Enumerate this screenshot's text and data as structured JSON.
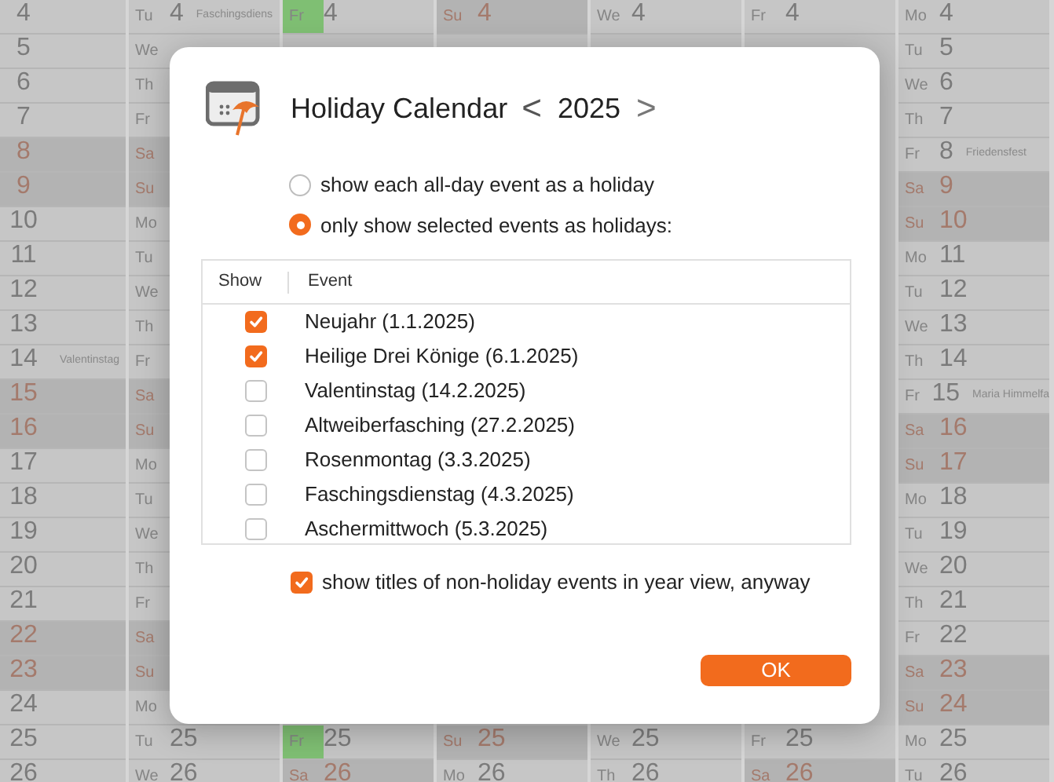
{
  "calendar": {
    "columns": [
      {
        "top": [
          {
            "day": "4",
            "weekend": false
          },
          {
            "day": "5",
            "weekend": false
          },
          {
            "day": "6",
            "weekend": false
          },
          {
            "day": "7",
            "weekend": false
          },
          {
            "day": "8",
            "weekend": true
          },
          {
            "day": "9",
            "weekend": true
          },
          {
            "day": "10",
            "weekend": false
          },
          {
            "day": "11",
            "weekend": false
          },
          {
            "day": "12",
            "weekend": false
          },
          {
            "day": "13",
            "weekend": false
          },
          {
            "day": "14",
            "weekend": false,
            "event": "Valentinstag"
          },
          {
            "day": "15",
            "weekend": true
          },
          {
            "day": "16",
            "weekend": true
          },
          {
            "day": "17",
            "weekend": false
          },
          {
            "day": "18",
            "weekend": false
          },
          {
            "day": "19",
            "weekend": false
          },
          {
            "day": "20",
            "weekend": false
          },
          {
            "day": "21",
            "weekend": false
          },
          {
            "day": "22",
            "weekend": true
          },
          {
            "day": "23",
            "weekend": true
          },
          {
            "day": "24",
            "weekend": false
          },
          {
            "day": "25",
            "weekend": false
          },
          {
            "day": "26",
            "weekend": false
          }
        ]
      },
      {
        "top": [
          {
            "weekday": "Tu",
            "day": "4",
            "weekend": false,
            "event": "Faschingsdiens"
          },
          {
            "weekday": "We",
            "weekend": false
          },
          {
            "weekday": "Th",
            "weekend": false
          },
          {
            "weekday": "Fr",
            "weekend": false
          },
          {
            "weekday": "Sa",
            "weekend": true
          },
          {
            "weekday": "Su",
            "weekend": true
          },
          {
            "weekday": "Mo",
            "weekend": false
          },
          {
            "weekday": "Tu",
            "weekend": false
          },
          {
            "weekday": "We",
            "weekend": false
          },
          {
            "weekday": "Th",
            "weekend": false
          },
          {
            "weekday": "Fr",
            "weekend": false
          },
          {
            "weekday": "Sa",
            "weekend": true
          },
          {
            "weekday": "Su",
            "weekend": true
          },
          {
            "weekday": "Mo",
            "weekend": false
          },
          {
            "weekday": "Tu",
            "weekend": false
          },
          {
            "weekday": "We",
            "weekend": false
          },
          {
            "weekday": "Th",
            "weekend": false
          },
          {
            "weekday": "Fr",
            "weekend": false
          },
          {
            "weekday": "Sa",
            "weekend": true
          },
          {
            "weekday": "Su",
            "weekend": true
          },
          {
            "weekday": "Mo",
            "weekend": false
          }
        ],
        "bottom": [
          {
            "weekday": "Tu",
            "day": "25",
            "weekend": false
          },
          {
            "weekday": "We",
            "day": "26",
            "weekend": false
          }
        ]
      },
      {
        "top": [
          {
            "weekday": "Fr",
            "day": "4",
            "weekend": false,
            "highlight": true
          }
        ],
        "bottom": [
          {
            "weekday": "Fr",
            "day": "25",
            "weekend": false,
            "highlight": true
          },
          {
            "weekday": "Sa",
            "day": "26",
            "weekend": true,
            "highlight": false
          }
        ]
      },
      {
        "top": [
          {
            "weekday": "Su",
            "day": "4",
            "weekend": true
          }
        ],
        "bottom": [
          {
            "weekday": "Su",
            "day": "25",
            "weekend": true
          },
          {
            "weekday": "Mo",
            "day": "26",
            "weekend": false
          }
        ]
      },
      {
        "top": [
          {
            "weekday": "We",
            "day": "4",
            "weekend": false
          }
        ],
        "bottom": [
          {
            "weekday": "We",
            "day": "25",
            "weekend": false
          },
          {
            "weekday": "Th",
            "day": "26",
            "weekend": false
          }
        ]
      },
      {
        "top": [
          {
            "weekday": "Fr",
            "day": "4",
            "weekend": false
          }
        ],
        "bottom": [
          {
            "weekday": "Fr",
            "day": "25",
            "weekend": false
          },
          {
            "weekday": "Sa",
            "day": "26",
            "weekend": true
          }
        ]
      },
      {
        "top": [
          {
            "weekday": "Mo",
            "day": "4",
            "weekend": false
          },
          {
            "weekday": "Tu",
            "day": "5",
            "weekend": false
          },
          {
            "weekday": "We",
            "day": "6",
            "weekend": false
          },
          {
            "weekday": "Th",
            "day": "7",
            "weekend": false
          },
          {
            "weekday": "Fr",
            "day": "8",
            "weekend": false,
            "event": "Friedensfest"
          },
          {
            "weekday": "Sa",
            "day": "9",
            "weekend": true
          },
          {
            "weekday": "Su",
            "day": "10",
            "weekend": true
          },
          {
            "weekday": "Mo",
            "day": "11",
            "weekend": false
          },
          {
            "weekday": "Tu",
            "day": "12",
            "weekend": false
          },
          {
            "weekday": "We",
            "day": "13",
            "weekend": false
          },
          {
            "weekday": "Th",
            "day": "14",
            "weekend": false
          },
          {
            "weekday": "Fr",
            "day": "15",
            "weekend": false,
            "event": "Maria Himmelfa"
          },
          {
            "weekday": "Sa",
            "day": "16",
            "weekend": true
          },
          {
            "weekday": "Su",
            "day": "17",
            "weekend": true
          },
          {
            "weekday": "Mo",
            "day": "18",
            "weekend": false
          },
          {
            "weekday": "Tu",
            "day": "19",
            "weekend": false
          },
          {
            "weekday": "We",
            "day": "20",
            "weekend": false
          },
          {
            "weekday": "Th",
            "day": "21",
            "weekend": false
          },
          {
            "weekday": "Fr",
            "day": "22",
            "weekend": false
          },
          {
            "weekday": "Sa",
            "day": "23",
            "weekend": true
          },
          {
            "weekday": "Su",
            "day": "24",
            "weekend": true
          },
          {
            "weekday": "Mo",
            "day": "25",
            "weekend": false
          },
          {
            "weekday": "Tu",
            "day": "26",
            "weekend": false
          }
        ]
      }
    ]
  },
  "dialog": {
    "title": "Holiday Calendar",
    "prev": "<",
    "year": "2025",
    "next": ">",
    "modes": [
      {
        "label": "show each all-day event as a holiday",
        "selected": false
      },
      {
        "label": "only show selected events as holidays:",
        "selected": true
      }
    ],
    "table": {
      "columns": [
        "Show",
        "Event"
      ],
      "rows": [
        {
          "checked": true,
          "event": "Neujahr (1.1.2025)"
        },
        {
          "checked": true,
          "event": "Heilige Drei Könige (6.1.2025)"
        },
        {
          "checked": false,
          "event": "Valentinstag (14.2.2025)"
        },
        {
          "checked": false,
          "event": "Altweiberfasching (27.2.2025)"
        },
        {
          "checked": false,
          "event": "Rosenmontag (3.3.2025)"
        },
        {
          "checked": false,
          "event": "Faschingsdienstag (4.3.2025)"
        },
        {
          "checked": false,
          "event": "Aschermittwoch (5.3.2025)"
        }
      ]
    },
    "show_titles": {
      "label": "show titles of non-holiday events in year view, anyway",
      "checked": true
    },
    "ok": "OK"
  }
}
